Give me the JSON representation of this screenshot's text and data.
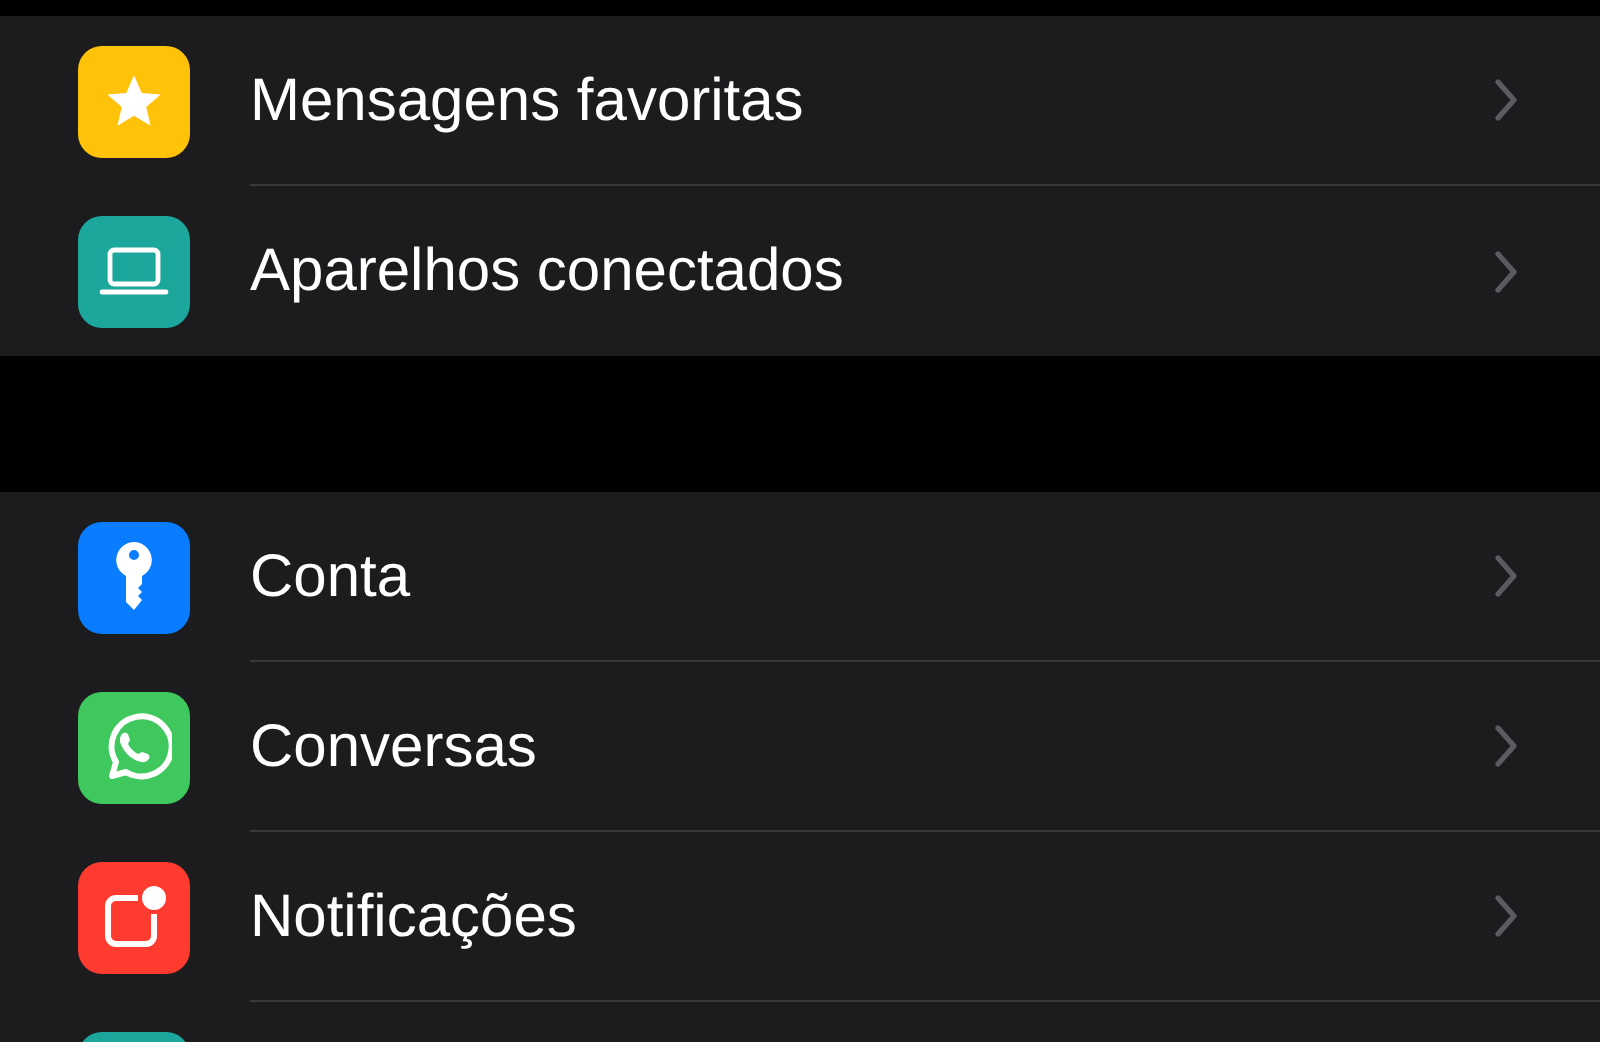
{
  "groups": [
    {
      "items": [
        {
          "kind": "star",
          "color": "#fec309",
          "label": "Mensagens favoritas"
        },
        {
          "kind": "laptop",
          "color": "#1ba79c",
          "label": "Aparelhos conectados"
        }
      ]
    },
    {
      "items": [
        {
          "kind": "key",
          "color": "#0a7cff",
          "label": "Conta"
        },
        {
          "kind": "chat",
          "color": "#3fc85e",
          "label": "Conversas"
        },
        {
          "kind": "notification",
          "color": "#ff3b30",
          "label": "Notificações"
        },
        {
          "kind": "blank",
          "color": "#1ba79c"
        }
      ]
    }
  ]
}
